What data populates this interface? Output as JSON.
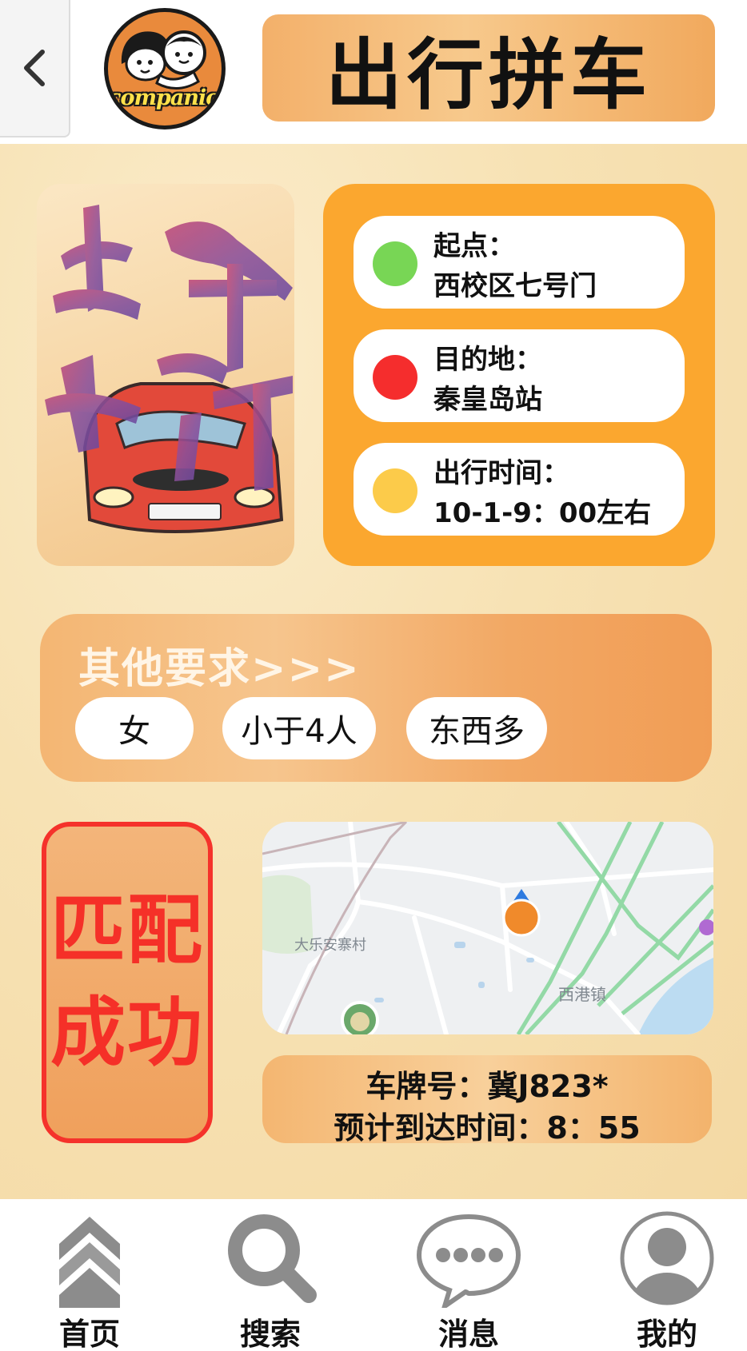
{
  "header": {
    "logo_text": "companion",
    "title": "出行拼车"
  },
  "poster": {
    "calligraphy_text": "安全出行"
  },
  "route": {
    "origin": {
      "label": "起点：",
      "value": "西校区七号门",
      "dot_color": "#78d655"
    },
    "destination": {
      "label": "目的地：",
      "value": "秦皇岛站",
      "dot_color": "#f52d2d"
    },
    "time": {
      "label": "出行时间：",
      "value": "10-1-9：00左右",
      "dot_color": "#fccb4a"
    }
  },
  "requirements": {
    "title": "其他要求>>>",
    "tags": [
      "女",
      "小于4人",
      "东西多"
    ]
  },
  "match": {
    "line1": "匹配",
    "line2": "成功"
  },
  "map": {
    "labels": [
      "大乐安寨村",
      "西港镇"
    ],
    "marker_icon": "location-pin-icon"
  },
  "car": {
    "plate": "车牌号：冀J823*",
    "eta": "预计到达时间：8：55"
  },
  "nav": {
    "items": [
      {
        "label": "首页",
        "icon": "home-chevrons-icon"
      },
      {
        "label": "搜索",
        "icon": "search-icon"
      },
      {
        "label": "消息",
        "icon": "message-bubble-icon"
      },
      {
        "label": "我的",
        "icon": "profile-avatar-icon"
      }
    ]
  },
  "colors": {
    "route_card": "#fba72f",
    "match_red": "#f53028",
    "nav_icon_gray": "#8c8c8c"
  }
}
